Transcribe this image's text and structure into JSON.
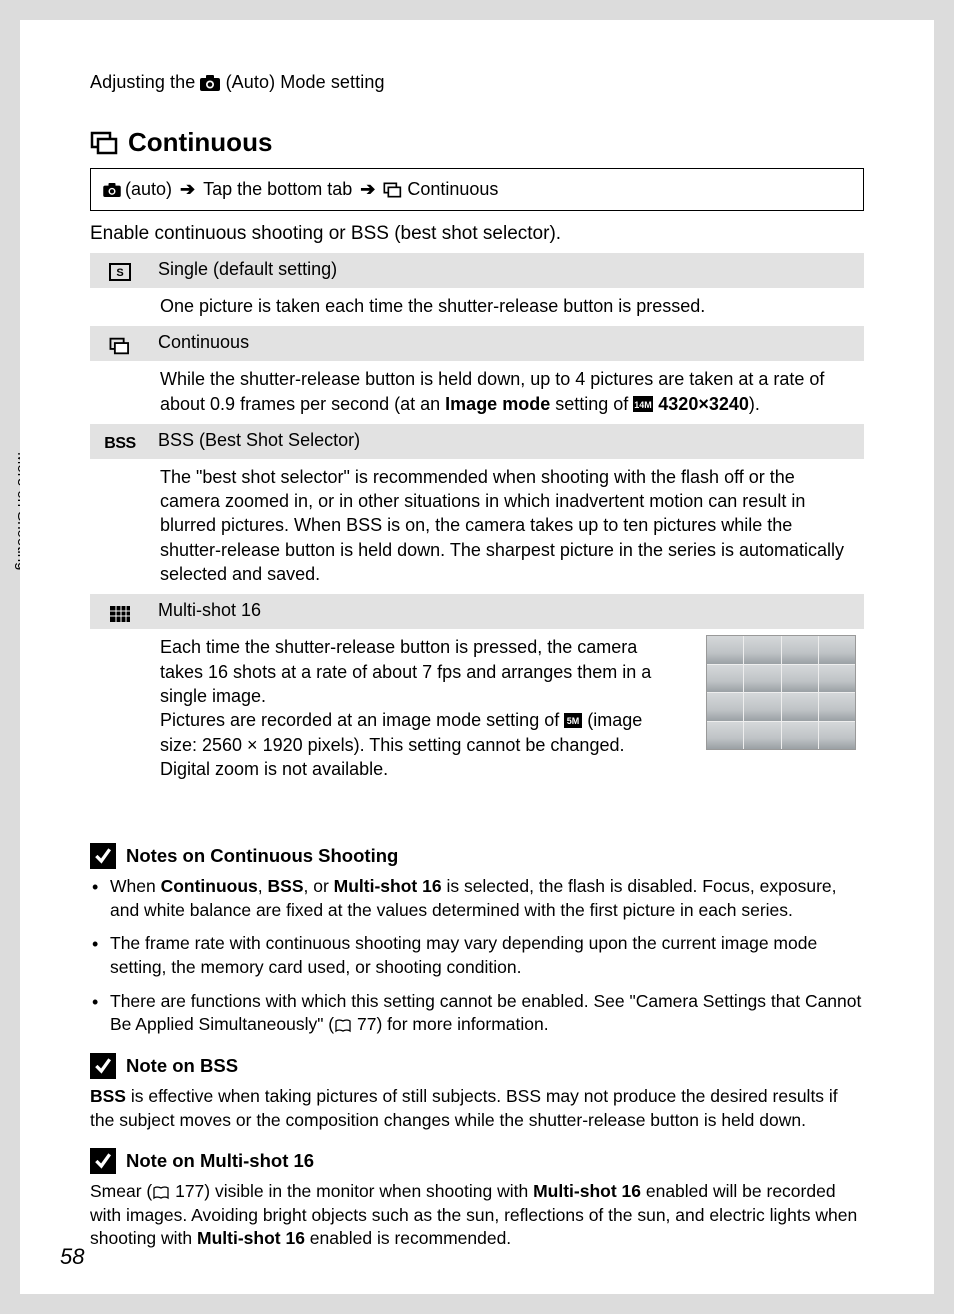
{
  "header": {
    "prefix": "Adjusting the ",
    "suffix": " (Auto) Mode setting"
  },
  "section_title": "Continuous",
  "breadcrumb": {
    "step1": " (auto) ",
    "step2": " Tap the bottom tab ",
    "step3": " Continuous"
  },
  "intro": "Enable continuous shooting or BSS (best shot selector).",
  "side_tab": "More on Shooting",
  "options": {
    "single": {
      "label": "Single (default setting)",
      "desc": "One picture is taken each time the shutter-release button is pressed."
    },
    "continuous": {
      "label": "Continuous",
      "desc_pre": "While the shutter-release button is held down, up to 4 pictures are taken at a rate of about 0.9 frames per second (at an ",
      "desc_bold1": "Image mode",
      "desc_mid": " setting of ",
      "desc_bold2": "4320×3240",
      "desc_post": ")."
    },
    "bss": {
      "label": "BSS (Best Shot Selector)",
      "icon_text": "BSS",
      "desc": "The \"best shot selector\" is recommended when shooting with the flash off or the camera zoomed in, or in other situations in which inadvertent motion can result in blurred pictures. When BSS is on, the camera takes up to ten pictures while the shutter-release button is held down. The sharpest picture in the series is automatically selected and saved."
    },
    "multishot": {
      "label": "Multi-shot 16",
      "desc_p1": "Each time the shutter-release button is pressed, the camera takes 16 shots at a rate of about 7 fps and arranges them in a single image.",
      "desc_p2_pre": "Pictures are recorded at an image mode setting of ",
      "desc_p2_post": " (image size: 2560 × 1920 pixels). This setting cannot be changed.",
      "desc_p3": "Digital zoom is not available."
    }
  },
  "notes": {
    "continuous": {
      "heading": "Notes on Continuous Shooting",
      "items": {
        "0_pre": "When ",
        "0_b1": "Continuous",
        "0_m1": ", ",
        "0_b2": "BSS",
        "0_m2": ", or ",
        "0_b3": "Multi-shot 16",
        "0_post": " is selected, the flash is disabled. Focus, exposure, and white balance are fixed at the values determined with the first picture in each series.",
        "1": "The frame rate with continuous shooting may vary depending upon the current image mode setting, the memory card used, or shooting condition.",
        "2_pre": "There are functions with which this setting cannot be enabled. See \"Camera Settings that Cannot Be Applied Simultaneously\" (",
        "2_page": " 77) for more information."
      }
    },
    "bss": {
      "heading": "Note on BSS",
      "body_b": "BSS",
      "body_post": " is effective when taking pictures of still subjects. BSS may not produce the desired results if the subject moves or the composition changes while the shutter-release button is held down."
    },
    "multishot": {
      "heading": "Note on Multi-shot 16",
      "body_pre": "Smear (",
      "body_page": " 177) visible in the monitor when shooting with ",
      "body_b1": "Multi-shot 16",
      "body_mid": " enabled will be recorded with images. Avoiding bright objects such as the sun, reflections of the sun, and electric lights when shooting with ",
      "body_b2": "Multi-shot 16",
      "body_post": " enabled is recommended."
    }
  },
  "page_number": "58"
}
